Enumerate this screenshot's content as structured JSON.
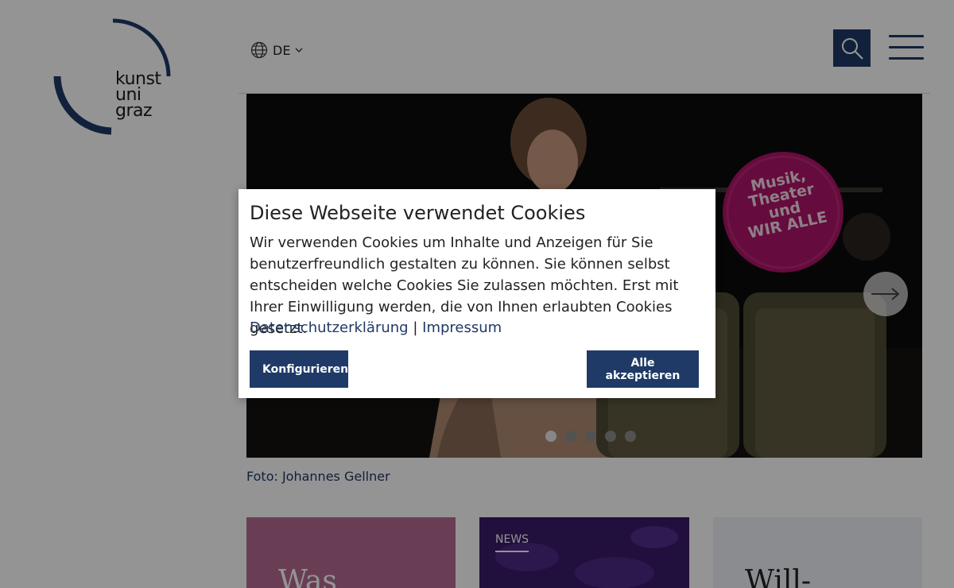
{
  "header": {
    "logo_lines": [
      "kunst",
      "uni",
      "graz"
    ],
    "language": "DE",
    "search_icon": "search-icon",
    "menu_icon": "hamburger-menu-icon"
  },
  "hero": {
    "badge_lines": [
      "Musik,",
      "Theater",
      "und",
      "WIR ALLE"
    ],
    "caption": "Foto: Johannes Gellner",
    "slide_count": 5,
    "active_slide": 1
  },
  "cards": [
    {
      "title": "Was",
      "color": "#b56b93"
    },
    {
      "tag": "NEWS",
      "color": "#3a1a6b"
    },
    {
      "title": "Will-",
      "color": "#eef2f7"
    }
  ],
  "cookie_dialog": {
    "title": "Diese Webseite verwendet Cookies",
    "body": "Wir verwenden Cookies um Inhalte und Anzeigen für Sie benutzerfreundlich gestalten zu können. Sie können selbst entscheiden welche Cookies Sie zulassen möchten. Erst mit Ihrer Einwilligung werden, die von Ihnen erlaubten Cookies gesetzt.",
    "privacy_link": "Datenschutzerklärung",
    "separator": "|",
    "imprint_link": "Impressum",
    "configure_label": "Konfigurieren",
    "accept_label": "Alle akzeptieren"
  },
  "colors": {
    "brand_blue": "#1f3a66",
    "badge_magenta": "#b0136a"
  }
}
